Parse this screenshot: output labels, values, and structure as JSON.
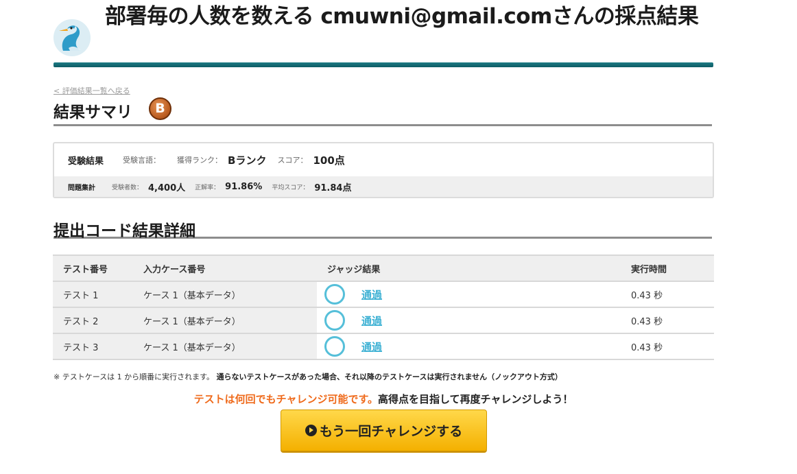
{
  "header": {
    "title": "部署毎の人数を数える cmuwni@gmail.comさんの採点結果",
    "logo_icon": "bird-logo-icon",
    "bar_color": "#156e78"
  },
  "back_link": "< 評価結果一覧へ戻る",
  "summary": {
    "heading": "結果サマリ",
    "rank_badge": "B",
    "result_label": "受験結果",
    "language_label": "受験言語：",
    "language_value": "",
    "rank_label": "獲得ランク：",
    "rank_value": "Bランク",
    "score_label": "スコア：",
    "score_value": "100点",
    "stats_label": "問題集計",
    "examinees_label": "受験者数：",
    "examinees_value": "4,400人",
    "accuracy_label": "正解率：",
    "accuracy_value": "91.86%",
    "avg_label": "平均スコア：",
    "avg_value": "91.84点"
  },
  "detail": {
    "heading": "提出コード結果詳細",
    "columns": [
      "テスト番号",
      "入力ケース番号",
      "ジャッジ結果",
      "実行時間"
    ],
    "rows": [
      {
        "test": "テスト 1",
        "case": "ケース 1（基本データ）",
        "judge": "通過",
        "time": "0.43 秒"
      },
      {
        "test": "テスト 2",
        "case": "ケース 1（基本データ）",
        "judge": "通過",
        "time": "0.43 秒"
      },
      {
        "test": "テスト 3",
        "case": "ケース 1（基本データ）",
        "judge": "通過",
        "time": "0.43 秒"
      }
    ]
  },
  "note": {
    "normal": "※ テストケースは 1 から順番に実行されます。",
    "bold": "通らないテストケースがあった場合、それ以降のテストケースは実行されません（ノックアウト方式）"
  },
  "challenge": {
    "orange_text": "テストは何回でもチャレンジ可能です。",
    "black_text": "高得点を目指して再度チャレンジしよう！",
    "button_label": "もう一回チャレンジする"
  },
  "colors": {
    "pass": "#3bb0d3",
    "orange": "#ef6a1b",
    "button": "#f7c21f"
  }
}
